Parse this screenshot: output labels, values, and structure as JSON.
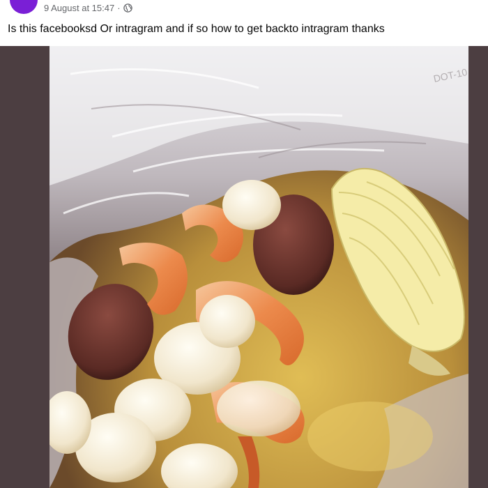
{
  "post": {
    "timestamp": "9 August at 15:47",
    "separator": "·",
    "audience_icon": "globe-icon",
    "text": "Is this facebooksd Or intragram and if so how to get backto intragram thanks"
  },
  "photo": {
    "bag_print": "DOT-10"
  },
  "colors": {
    "avatar": "#7a1fd6",
    "frame": "#4c3e41",
    "meta_text": "#65676b"
  }
}
